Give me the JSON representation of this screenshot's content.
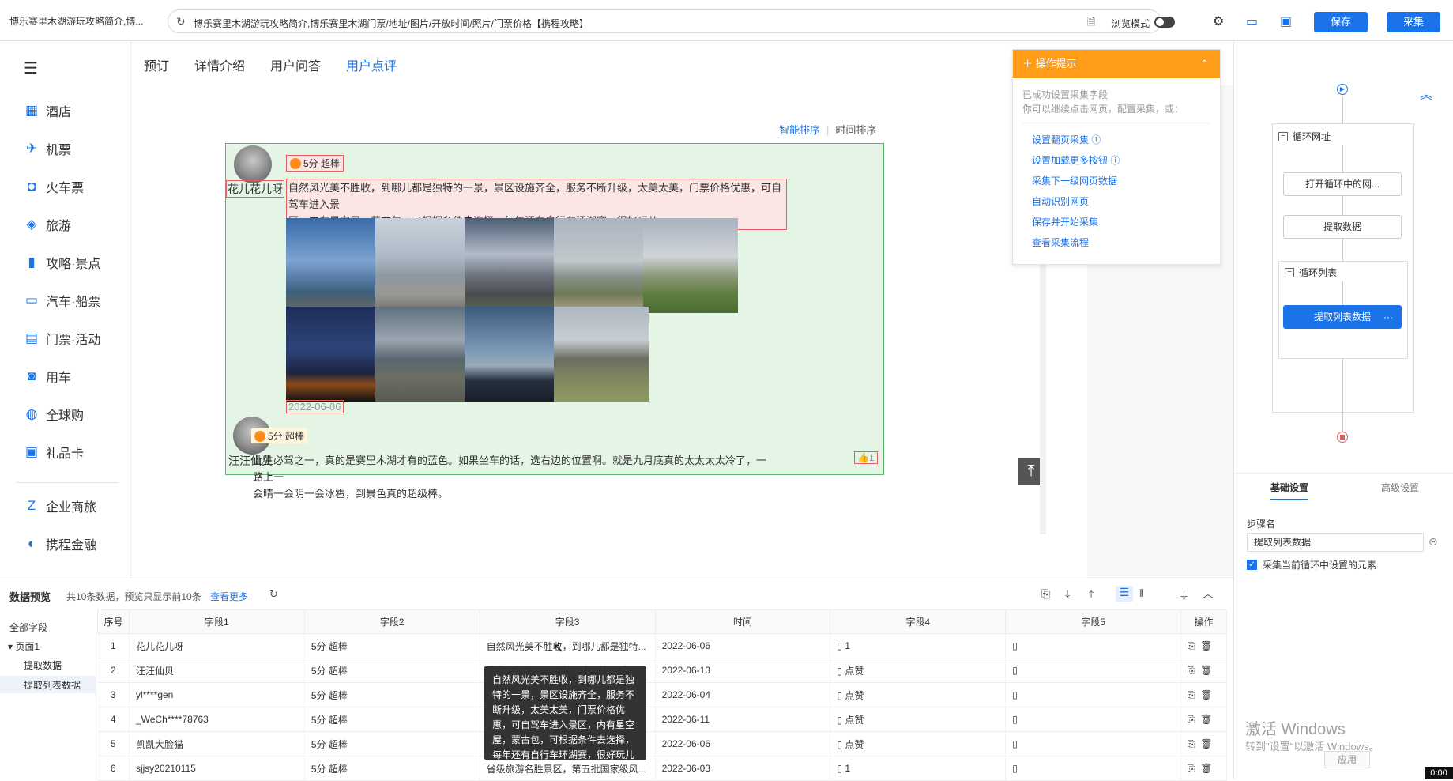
{
  "browser": {
    "tab_title": "博乐赛里木湖游玩攻略简介,博...",
    "url": "博乐赛里木湖游玩攻略简介,博乐赛里木湖门票/地址/图片/开放时间/照片/门票价格【携程攻略】",
    "browse_mode": "浏览模式",
    "save": "保存",
    "collect": "采集"
  },
  "leftnav": {
    "items": [
      {
        "label": "酒店",
        "icon": "hotel-icon"
      },
      {
        "label": "机票",
        "icon": "plane-icon"
      },
      {
        "label": "火车票",
        "icon": "train-icon"
      },
      {
        "label": "旅游",
        "icon": "travel-icon"
      },
      {
        "label": "攻略·景点",
        "icon": "guide-icon"
      },
      {
        "label": "汽车·船票",
        "icon": "bus-icon"
      },
      {
        "label": "门票·活动",
        "icon": "ticket-icon"
      },
      {
        "label": "用车",
        "icon": "car-icon"
      },
      {
        "label": "全球购",
        "icon": "globe-icon"
      },
      {
        "label": "礼品卡",
        "icon": "giftcard-icon"
      }
    ],
    "bottom_items": [
      {
        "label": "企业商旅",
        "icon": "business-icon"
      },
      {
        "label": "携程金融",
        "icon": "finance-icon"
      }
    ]
  },
  "tabs": [
    "预订",
    "详情介绍",
    "用户问答",
    "用户点评"
  ],
  "sort": {
    "smart": "智能排序",
    "time": "时间排序"
  },
  "reviews": [
    {
      "user": "花儿花儿呀",
      "rating": "5分 超棒",
      "text_line1": "自然风光美不胜收，到哪儿都是独特的一景，景区设施齐全，服务不断升级，太美太美，门票价格优惠，可自驾车进入景",
      "text_line2": "区，内有星空屋，蒙古包，可根据条件去选择，每年还有自行车环湖赛，很好玩儿",
      "date": "2022-06-06",
      "likes": "1"
    },
    {
      "user": "汪汪仙贝",
      "rating": "5分 超棒",
      "text_line1": "此生必驾之一，真的是赛里木湖才有的蓝色。如果坐车的话，选右边的位置啊。就是九月底真的太太太太冷了，一路上一",
      "text_line2": "会晴一会阴一会冰雹，到景色真的超级棒。"
    }
  ],
  "tip": {
    "title": "操作提示",
    "intro1": "已成功设置采集字段",
    "intro2": "你可以继续点击网页，配置采集，或：",
    "links": [
      "设置翻页采集",
      "设置加载更多按钮",
      "采集下一级网页数据",
      "自动识别网页",
      "保存并开始采集",
      "查看采集流程"
    ]
  },
  "flow": {
    "loop_url": "循环网址",
    "open_loop": "打开循环中的网...",
    "extract": "提取数据",
    "loop_list": "循环列表",
    "extract_list": "提取列表数据"
  },
  "settings": {
    "tab_basic": "基础设置",
    "tab_advanced": "高级设置",
    "step_name_label": "步骤名",
    "step_name_value": "提取列表数据",
    "checkbox_label": "采集当前循环中设置的元素"
  },
  "preview": {
    "title": "数据预览",
    "count": "共10条数据，预览只显示前10条",
    "more": "查看更多",
    "tree": {
      "all": "全部字段",
      "page": "页面1",
      "extract": "提取数据",
      "extract_list": "提取列表数据"
    },
    "columns": [
      "序号",
      "字段1",
      "字段2",
      "字段3",
      "时间",
      "字段4",
      "字段5",
      "操作"
    ],
    "rows": [
      [
        "1",
        "花儿花儿呀",
        "5分 超棒",
        "自然风光美不胜收，到哪儿都是独特...",
        "2022-06-06",
        "▯ 1",
        "▯"
      ],
      [
        "2",
        "汪汪仙贝",
        "5分 超棒",
        "此生必驾之一，真的是赛里木湖才有...",
        "2022-06-13",
        "▯ 点赞",
        "▯"
      ],
      [
        "3",
        "yl****gen",
        "5分 超棒",
        "",
        "2022-06-04",
        "▯ 点赞",
        "▯"
      ],
      [
        "4",
        "_WeCh****78763",
        "5分 超棒",
        "",
        "2022-06-11",
        "▯ 点赞",
        "▯"
      ],
      [
        "5",
        "凯凯大脸猫",
        "5分 超棒",
        "",
        "2022-06-06",
        "▯ 点赞",
        "▯"
      ],
      [
        "6",
        "sjjsy20210115",
        "5分 超棒",
        "省级旅游名胜景区，第五批国家级风...",
        "2022-06-03",
        "▯ 1",
        "▯"
      ]
    ],
    "tooltip": "自然风光美不胜收，到哪儿都是独特的一景，景区设施齐全，服务不断升级，太美太美，门票价格优惠，可自驾车进入景区，内有星空屋，蒙古包，可根据条件去选择，每年还有自行车环湖赛，很好玩儿"
  },
  "windows": {
    "activate": "激活 Windows",
    "activate_sub": "转到\"设置\"以激活 Windows。",
    "apply": "应用"
  },
  "clock": "0:00",
  "colors": {
    "accent": "#1a73e8",
    "tip_orange": "#ff9c1a",
    "selected_green": "#e4f5e6"
  }
}
